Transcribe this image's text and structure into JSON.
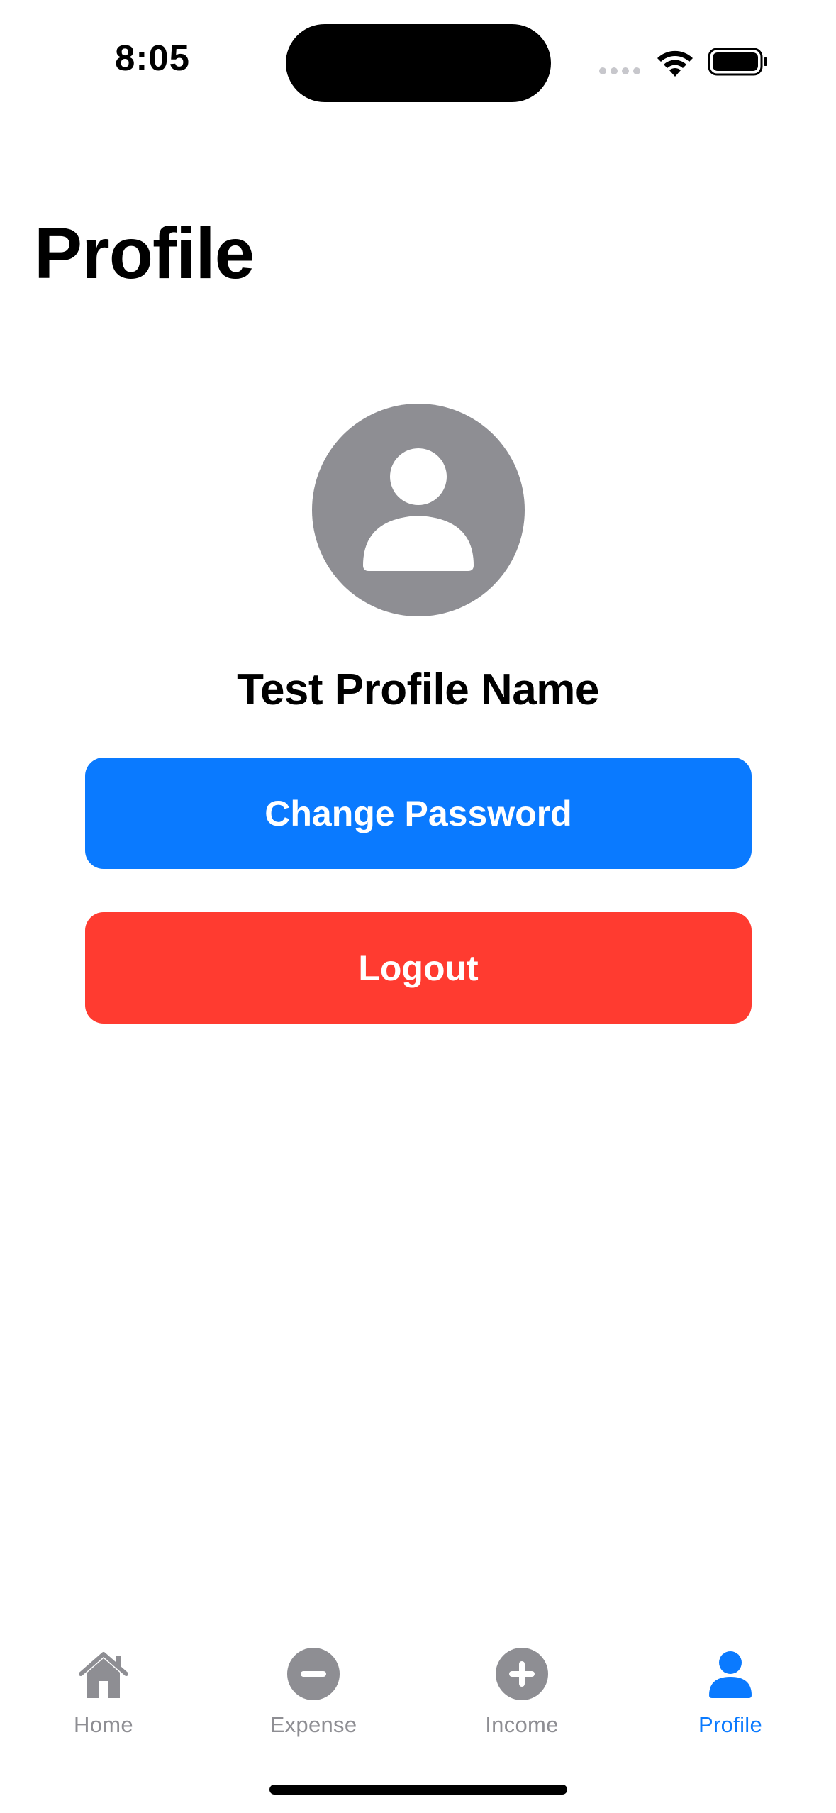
{
  "status_bar": {
    "time": "8:05",
    "icons": [
      "cellular-signal-icon",
      "wifi-icon",
      "battery-icon"
    ]
  },
  "header": {
    "title": "Profile"
  },
  "profile": {
    "avatar_icon": "person-circle-icon",
    "name": "Test Profile Name"
  },
  "actions": {
    "change_password_label": "Change Password",
    "logout_label": "Logout"
  },
  "tab_bar": {
    "items": [
      {
        "label": "Home",
        "icon": "house-icon",
        "active": false
      },
      {
        "label": "Expense",
        "icon": "minus-circle-icon",
        "active": false
      },
      {
        "label": "Income",
        "icon": "plus-circle-icon",
        "active": false
      },
      {
        "label": "Profile",
        "icon": "person-icon",
        "active": true
      }
    ]
  },
  "colors": {
    "accent": "#0a7aff",
    "destructive": "#ff3b30",
    "inactive": "#8e8e93",
    "avatar_bg": "#8e8e93"
  }
}
